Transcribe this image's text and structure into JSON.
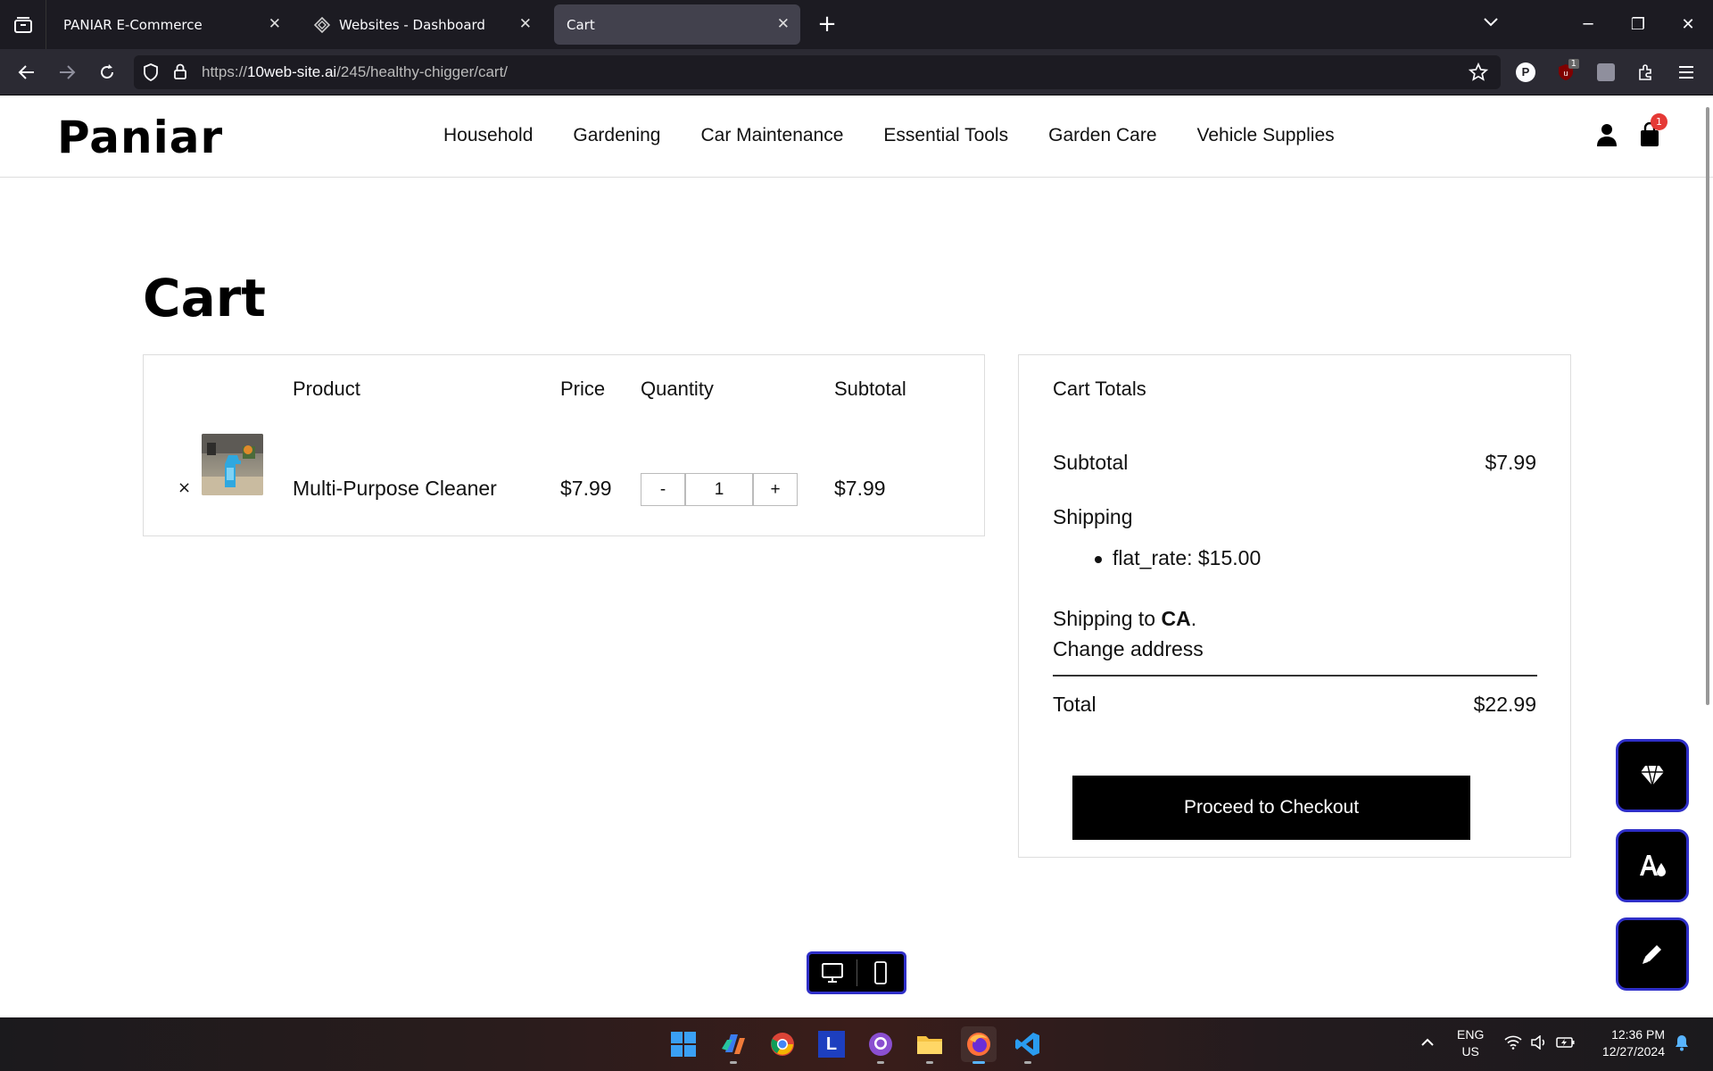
{
  "browser": {
    "tabs": [
      {
        "title": "PANIAR E-Commerce",
        "active": false
      },
      {
        "title": "Websites - Dashboard",
        "active": false
      },
      {
        "title": "Cart",
        "active": true
      }
    ],
    "url_prefix": "https://",
    "url_host": "10web-site.ai",
    "url_path": "/245/healthy-chigger/cart/",
    "extension_badge": "1"
  },
  "site": {
    "logo": "Paniar",
    "menu": [
      "Household",
      "Gardening",
      "Car Maintenance",
      "Essential Tools",
      "Garden Care",
      "Vehicle Supplies"
    ],
    "cart_count": "1"
  },
  "page": {
    "title": "Cart",
    "table_headers": {
      "product": "Product",
      "price": "Price",
      "quantity": "Quantity",
      "subtotal": "Subtotal"
    },
    "item": {
      "remove": "×",
      "name": "Multi-Purpose Cleaner",
      "price": "$7.99",
      "qty_minus": "-",
      "quantity": "1",
      "qty_plus": "+",
      "subtotal": "$7.99"
    },
    "totals": {
      "heading": "Cart Totals",
      "subtotal_label": "Subtotal",
      "subtotal_value": "$7.99",
      "shipping_label": "Shipping",
      "shipping_method": "flat_rate: $15.00",
      "shipping_to_prefix": "Shipping to",
      "shipping_to_country": "CA",
      "shipping_to_suffix": ".",
      "change_address": "Change address",
      "total_label": "Total",
      "total_value": "$22.99",
      "checkout_button": "Proceed to Checkout"
    }
  },
  "taskbar": {
    "lang_1": "ENG",
    "lang_2": "US",
    "time": "12:36 PM",
    "date": "12/27/2024"
  }
}
